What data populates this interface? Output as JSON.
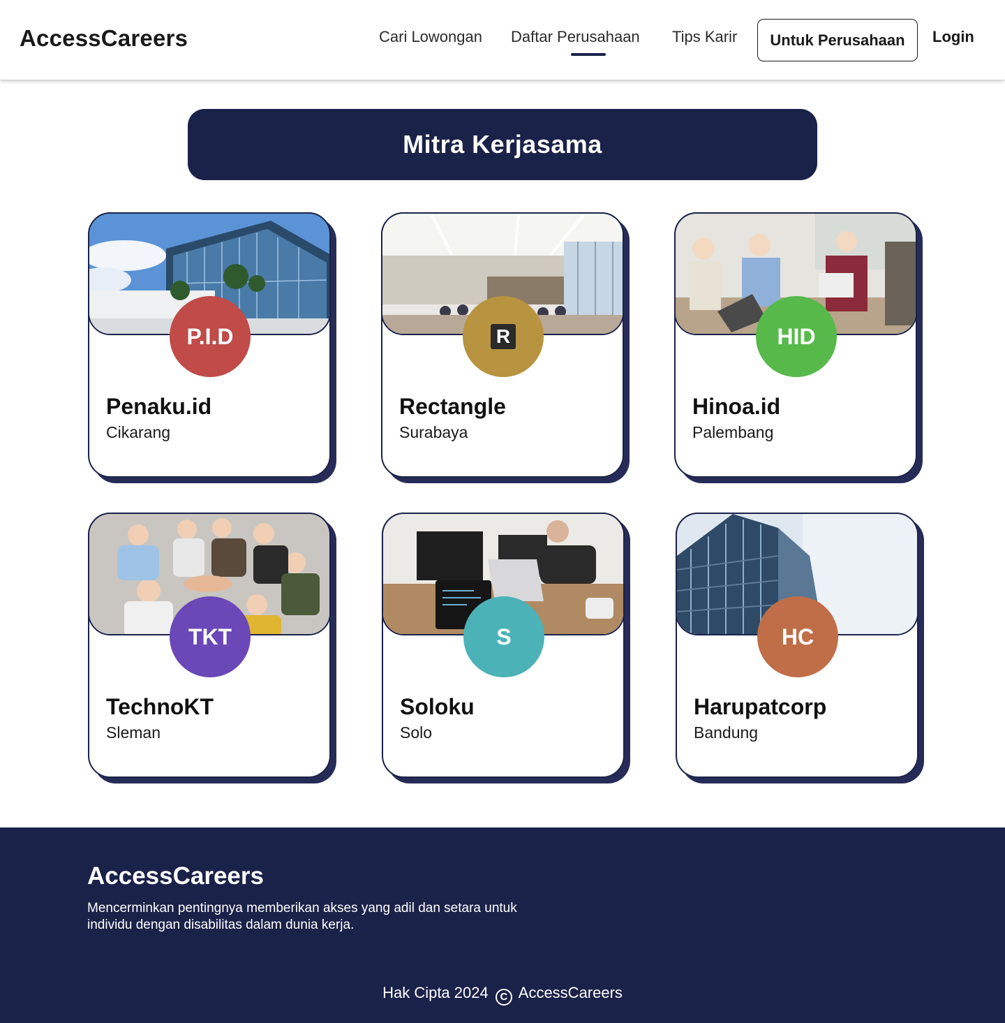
{
  "header": {
    "logo": "AccessCareers",
    "nav": [
      "Cari Lowongan",
      "Daftar Perusahaan",
      "Tips Karir"
    ],
    "active_nav": "Daftar Perusahaan",
    "company_button": "Untuk Perusahaan",
    "login": "Login"
  },
  "banner": {
    "title": "Mitra Kerjasama"
  },
  "companies": [
    {
      "initials": "P.I.D",
      "name": "Penaku.id",
      "city": "Cikarang",
      "color": "#c04b48",
      "photo": "glass-office-building"
    },
    {
      "initials": "R",
      "name": "Rectangle",
      "city": "Surabaya",
      "color": "#b89440",
      "photo": "conference-room"
    },
    {
      "initials": "HID",
      "name": "Hinoa.id",
      "city": "Palembang",
      "color": "#56b94a",
      "photo": "team-meeting"
    },
    {
      "initials": "TKT",
      "name": "TechnoKT",
      "city": "Sleman",
      "color": "#6b48b8",
      "photo": "team-huddle"
    },
    {
      "initials": "S",
      "name": "Soloku",
      "city": "Solo",
      "color": "#4bb2b8",
      "photo": "office-laptops"
    },
    {
      "initials": "HC",
      "name": "Harupatcorp",
      "city": "Bandung",
      "color": "#c06e48",
      "photo": "skyscraper"
    }
  ],
  "footer": {
    "logo": "AccessCareers",
    "description": "Mencerminkan pentingnya memberikan akses yang adil dan setara untuk individu dengan disabilitas dalam dunia kerja.",
    "copyright_prefix": "Hak Cipta 2024",
    "copyright_icon": "copyright-icon",
    "copyright_suffix": "AccessCareers"
  },
  "colors": {
    "navy": "#1b2249",
    "white": "#ffffff"
  }
}
